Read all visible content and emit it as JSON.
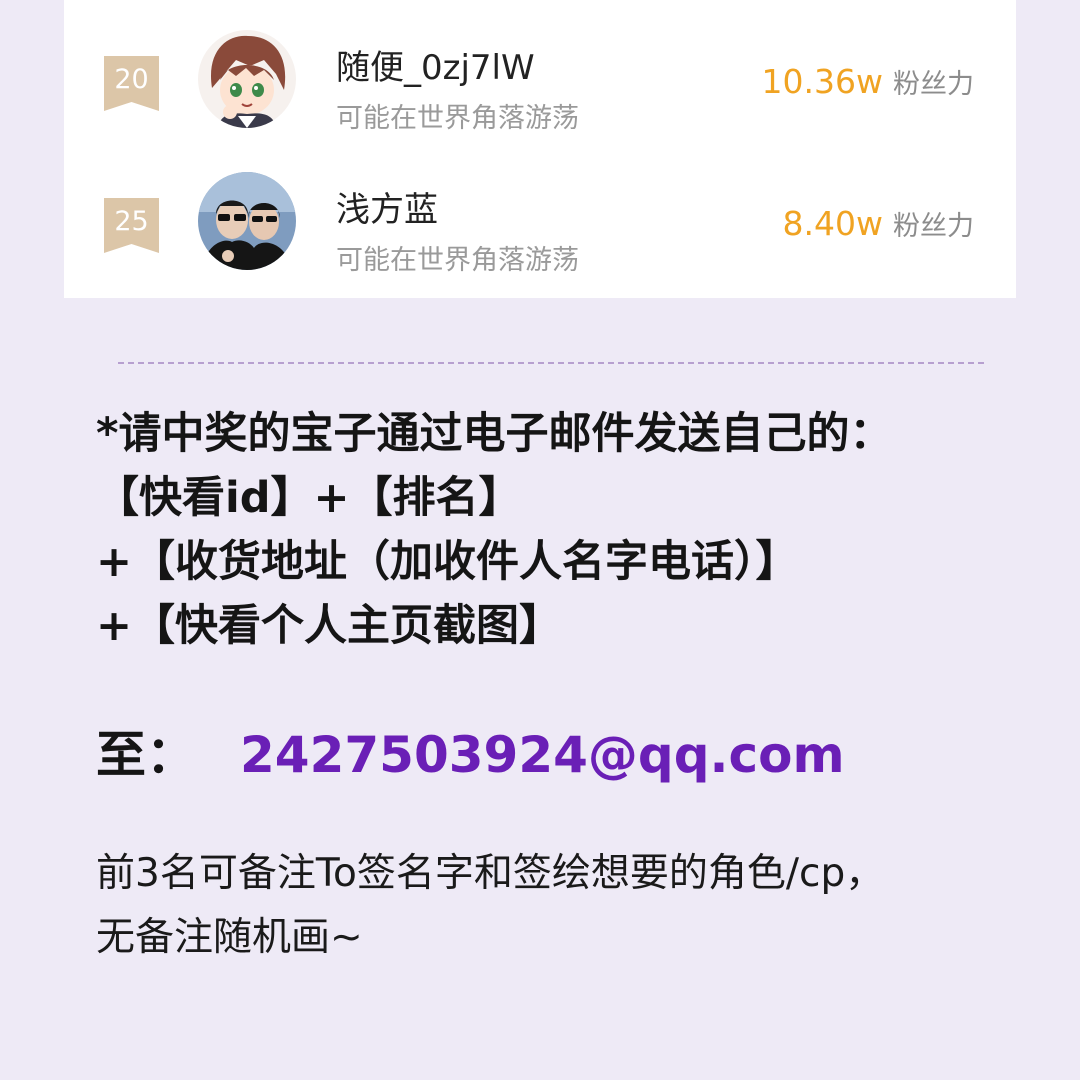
{
  "ranking": {
    "rows": [
      {
        "rank": "20",
        "name": "随便_0zj7lW",
        "status": "可能在世界角落游荡",
        "value": "10.36w",
        "unit": "粉丝力"
      },
      {
        "rank": "25",
        "name": "浅方蓝",
        "status": "可能在世界角落游荡",
        "value": "8.40w",
        "unit": "粉丝力"
      }
    ]
  },
  "notice": {
    "line1": "*请中奖的宝子通过电子邮件发送自己的：",
    "line2": "【快看id】+【排名】",
    "line3": "+【收货地址（加收件人名字电话）】",
    "line4": "+【快看个人主页截图】"
  },
  "email": {
    "prefix": "至：",
    "address": "2427503924@qq.com"
  },
  "remarks": {
    "line1": "前3名可备注To签名字和签绘想要的角色/cp，",
    "line2": "无备注随机画~"
  },
  "colors": {
    "background": "#eeeaf6",
    "card": "#ffffff",
    "rank_badge": "#dcc6a8",
    "metric_value": "#f0a322",
    "email": "#6a1fb6",
    "divider": "#b7a0d0"
  }
}
